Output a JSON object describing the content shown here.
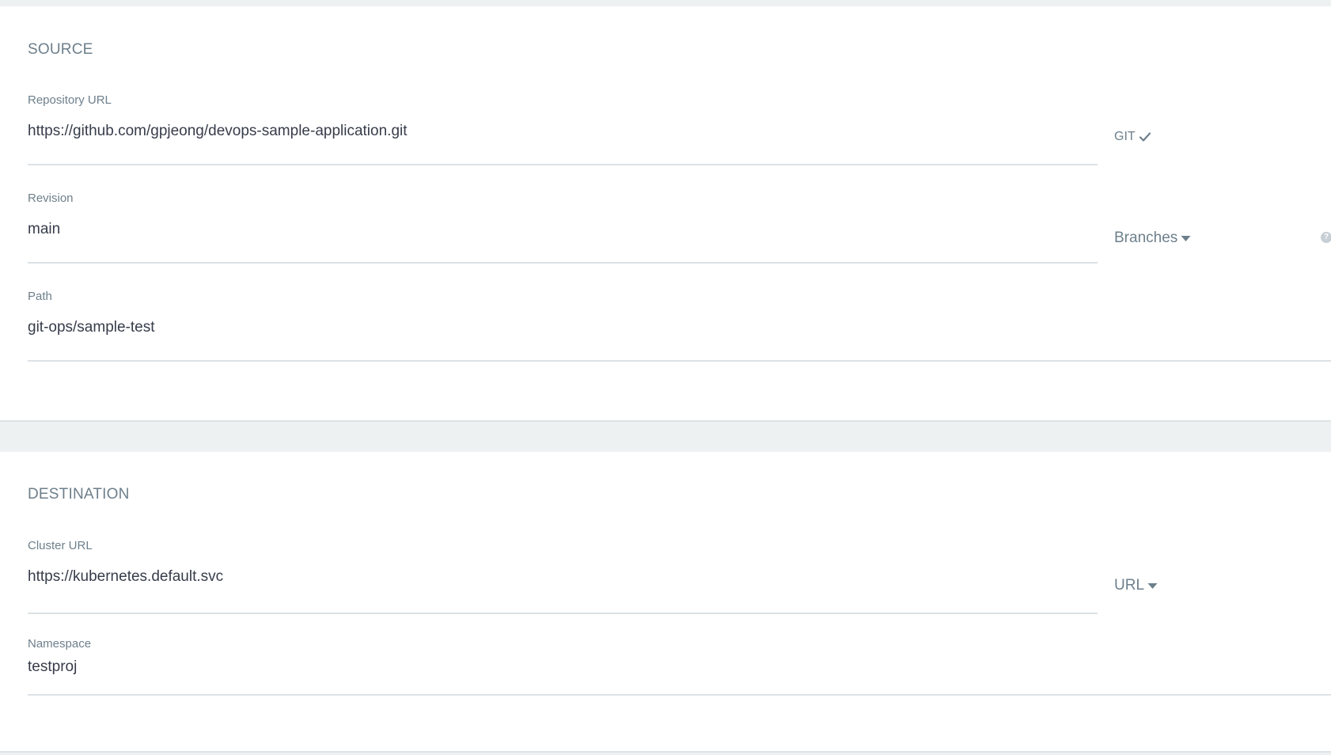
{
  "source": {
    "title": "SOURCE",
    "repository_url": {
      "label": "Repository URL",
      "value": "https://github.com/gpjeong/devops-sample-application.git",
      "type_label": "GIT",
      "type_icon": "check-icon"
    },
    "revision": {
      "label": "Revision",
      "value": "main",
      "selector_label": "Branches",
      "selector_icon": "caret-down-icon",
      "help_icon": "question-icon",
      "help_glyph": "?"
    },
    "path": {
      "label": "Path",
      "value": "git-ops/sample-test"
    }
  },
  "destination": {
    "title": "DESTINATION",
    "cluster_url": {
      "label": "Cluster URL",
      "value": "https://kubernetes.default.svc",
      "selector_label": "URL",
      "selector_icon": "caret-down-icon"
    },
    "namespace": {
      "label": "Namespace",
      "value": "testproj"
    }
  },
  "colors": {
    "background": "#eef1f2",
    "panel": "#ffffff",
    "label": "#6d7f8b",
    "text": "#363c4a",
    "underline": "#dce2e6"
  }
}
